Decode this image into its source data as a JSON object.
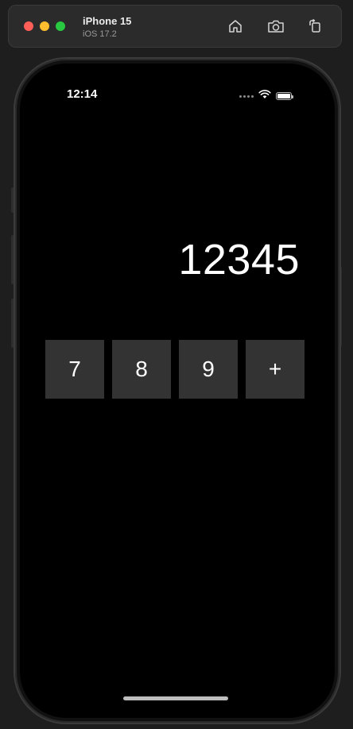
{
  "simulator": {
    "device_name": "iPhone 15",
    "os_version": "iOS 17.2",
    "toolbar_icons": [
      "home-icon",
      "screenshot-icon",
      "rotate-icon"
    ]
  },
  "status_bar": {
    "time": "12:14",
    "icons": [
      "cellular-icon",
      "wifi-icon",
      "battery-icon"
    ],
    "battery_level": 1.0
  },
  "calculator": {
    "display_value": "12345",
    "keys": [
      "7",
      "8",
      "9",
      "+"
    ]
  },
  "colors": {
    "screen_background": "#000000",
    "key_background": "#333333",
    "text": "#ffffff"
  }
}
